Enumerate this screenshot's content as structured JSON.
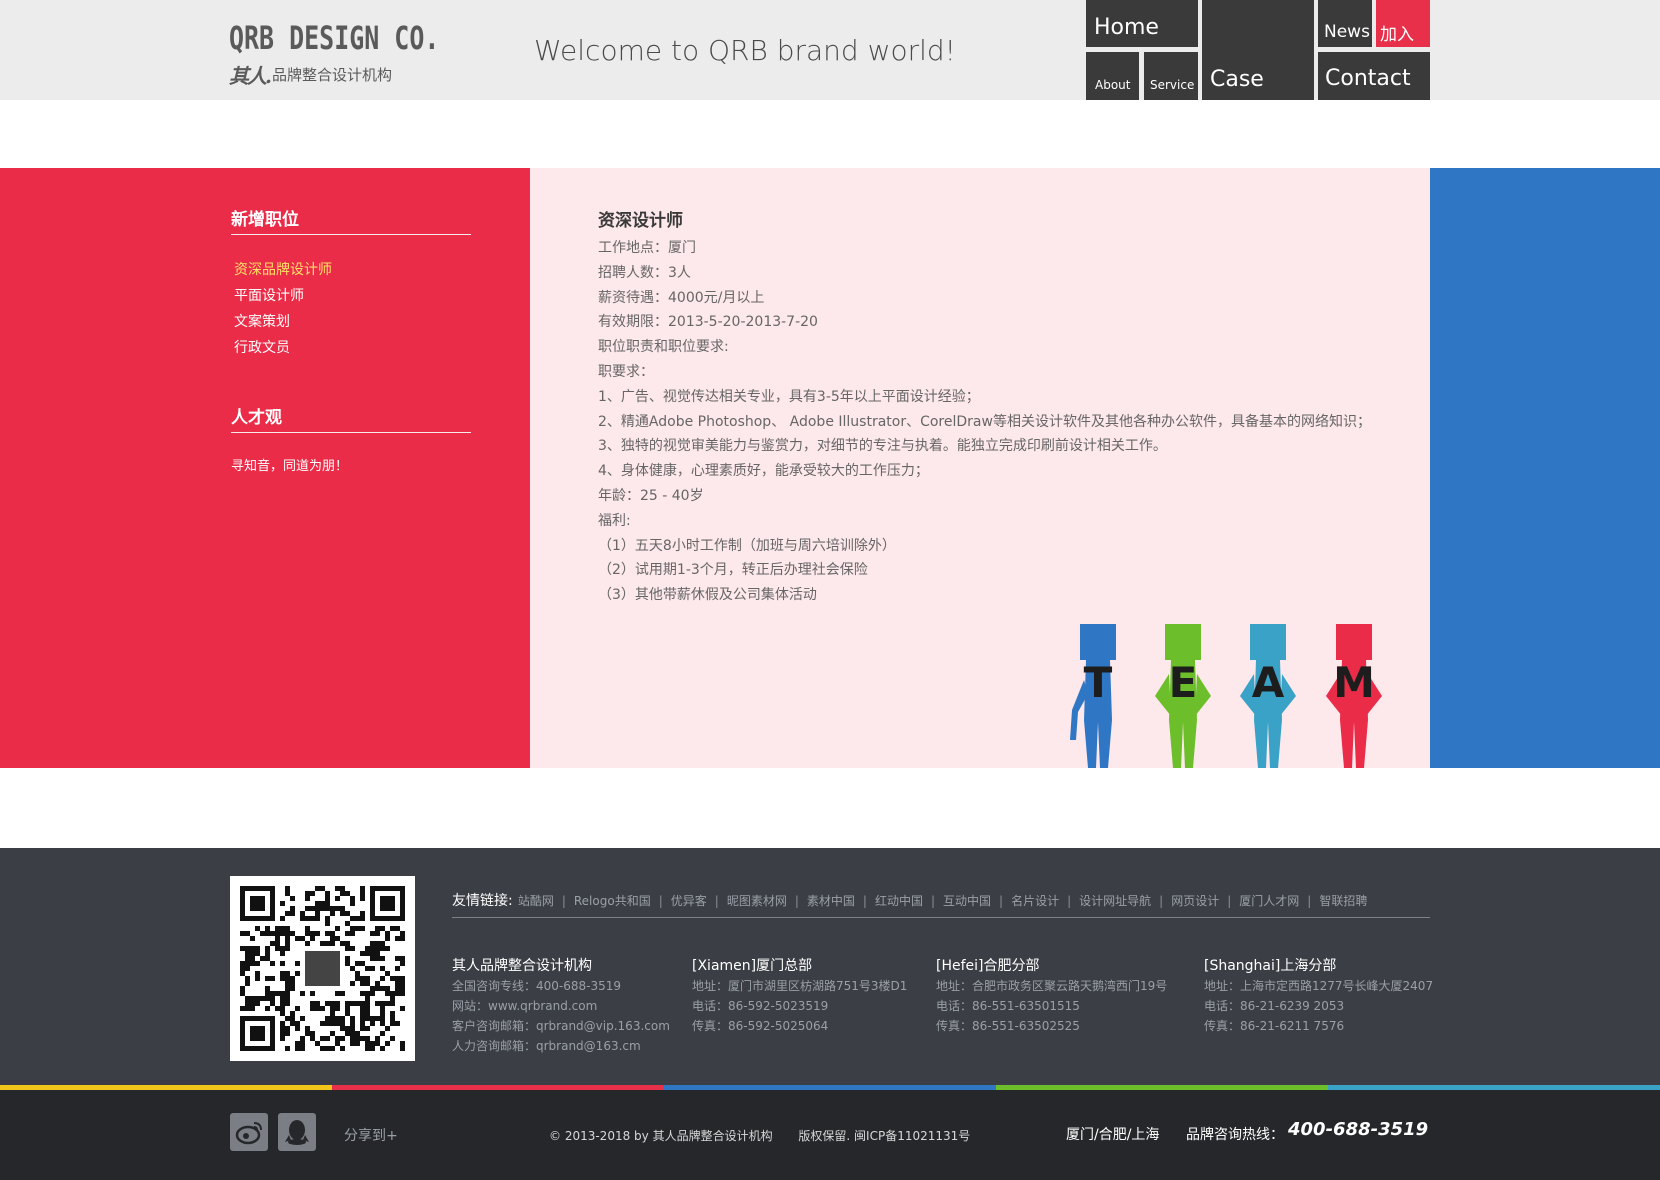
{
  "header": {
    "logo_main": "QRB DESIGN CO.",
    "logo_brush": "其人.",
    "logo_sub": "品牌整合设计机构",
    "welcome": "Welcome to QRB brand world!"
  },
  "nav": {
    "home": "Home",
    "case": "Case",
    "about": "About",
    "service": "Service",
    "news": "News",
    "join": "加入",
    "contact": "Contact"
  },
  "sidebar": {
    "section1_title": "新增职位",
    "positions": [
      "资深品牌设计师",
      "平面设计师",
      "文案策划",
      "行政文员"
    ],
    "active_index": 0,
    "section2_title": "人才观",
    "section2_text": "寻知音，同道为朋！"
  },
  "job": {
    "title": "资深设计师",
    "lines": [
      "工作地点：厦门",
      "招聘人数：3人",
      "薪资待遇：4000元/月以上",
      "有效期限：2013-5-20-2013-7-20",
      "职位职责和职位要求:",
      "职要求：",
      "1、广告、视觉传达相关专业，具有3-5年以上平面设计经验；",
      "2、精通Adobe Photoshop、 Adobe Illustrator、CorelDraw等相关设计软件及其他各种办公软件，具备基本的网络知识；",
      "3、独特的视觉审美能力与鉴赏力，对细节的专注与执着。能独立完成印刷前设计相关工作。",
      "4、身体健康，心理素质好，能承受较大的工作压力；",
      "年龄：25 - 40岁",
      "福利:",
      "（1）五天8小时工作制（加班与周六培训除外）",
      "（2）试用期1-3个月，转正后办理社会保险",
      "（3）其他带薪休假及公司集体活动"
    ]
  },
  "team": {
    "letters": [
      "T",
      "E",
      "A",
      "M"
    ],
    "colors": [
      "#2f77c4",
      "#6cbf2a",
      "#3aa2c6",
      "#ea2c49"
    ]
  },
  "footer": {
    "links_label": "友情链接:",
    "links": [
      "站酷网",
      "Relogo共和国",
      "优异客",
      "昵图素材网",
      "素材中国",
      "红动中国",
      "互动中国",
      "名片设计",
      "设计网址导航",
      "网页设计",
      "厦门人才网",
      "智联招聘"
    ],
    "offices": [
      {
        "title": "其人品牌整合设计机构",
        "lines": [
          "全国咨询专线：400-688-3519",
          "网站：www.qrbrand.com",
          "客户咨询邮箱：qrbrand@vip.163.com",
          "人力咨询邮箱：qrbrand@163.cm"
        ]
      },
      {
        "title": "[Xiamen]厦门总部",
        "lines": [
          "地址：厦门市湖里区枋湖路751号3楼D1",
          "电话：86-592-5023519",
          "传真：86-592-5025064"
        ]
      },
      {
        "title": "[Hefei]合肥分部",
        "lines": [
          "地址：合肥市政务区聚云路天鹅湾西门19号",
          "电话：86-551-63501515",
          "传真：86-551-63502525"
        ]
      },
      {
        "title": "[Shanghai]上海分部",
        "lines": [
          "地址：上海市定西路1277号长峰大厦2407",
          "电话：86-21-6239 2053",
          "传真：86-21-6211 7576"
        ]
      }
    ],
    "strip_colors": [
      "#f2c71a",
      "#e9304a",
      "#2f77c4",
      "#6cbf2a",
      "#3aa2c6"
    ],
    "social_icons": [
      "weibo-icon",
      "qq-icon"
    ],
    "share": "分享到+",
    "copyright": "© 2013-2018 by 其人品牌整合设计机构",
    "rights": "版权保留. 闽ICP备11021131号",
    "cities": "厦门/合肥/上海",
    "hotline_label": "品牌咨询热线：",
    "hotline": "400-688-3519"
  }
}
